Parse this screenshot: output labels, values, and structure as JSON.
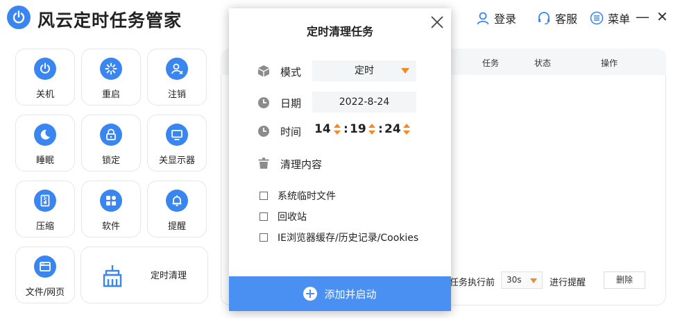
{
  "app": {
    "title": "风云定时任务管家"
  },
  "header": {
    "login": "登录",
    "support": "客服",
    "menu": "菜单",
    "minimize": "—",
    "close": "✕"
  },
  "tools": [
    {
      "label": "关机",
      "icon": "power-icon"
    },
    {
      "label": "重启",
      "icon": "restart-icon"
    },
    {
      "label": "注销",
      "icon": "logout-user-icon"
    },
    {
      "label": "睡眠",
      "icon": "moon-icon"
    },
    {
      "label": "锁定",
      "icon": "lock-icon"
    },
    {
      "label": "关显示器",
      "icon": "monitor-icon"
    },
    {
      "label": "压缩",
      "icon": "zip-icon"
    },
    {
      "label": "软件",
      "icon": "apps-icon"
    },
    {
      "label": "提醒",
      "icon": "bell-icon"
    },
    {
      "label": "文件/网页",
      "icon": "browser-icon"
    },
    {
      "label": "定时清理",
      "icon": "broom-icon"
    }
  ],
  "background_panel": {
    "columns": [
      "任务",
      "状态",
      "操作"
    ],
    "footer": {
      "before_label": "任务执行前",
      "select_value": "30s",
      "after_label": "进行提醒",
      "delete_button": "删除"
    }
  },
  "dialog": {
    "title": "定时清理任务",
    "mode": {
      "label": "模式",
      "value": "定时"
    },
    "date": {
      "label": "日期",
      "value": "2022-8-24"
    },
    "time": {
      "label": "时间",
      "hour": "14",
      "minute": "19",
      "second": "24"
    },
    "clean": {
      "label": "清理内容"
    },
    "options": [
      "系统临时文件",
      "回收站",
      "IE浏览器缓存/历史记录/Cookies"
    ],
    "action_button": "添加并启动"
  },
  "colors": {
    "accent": "#3a86f0",
    "action": "#4a8ff2",
    "caret": "#f08a24"
  }
}
